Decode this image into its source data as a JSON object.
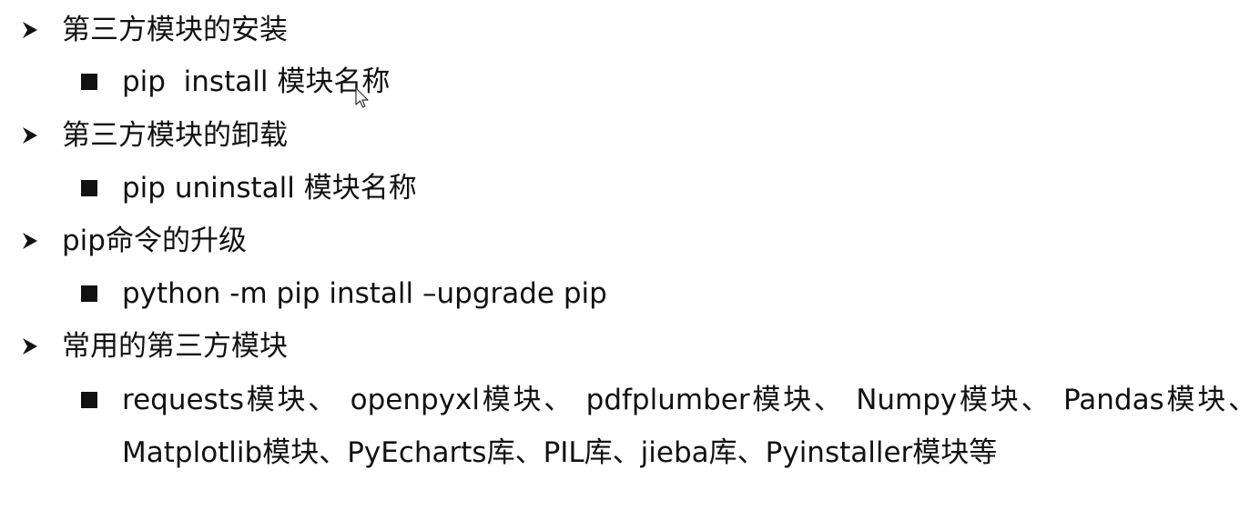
{
  "items": [
    {
      "label": "第三方模块的安装",
      "sub": "pip  install 模块名称"
    },
    {
      "label": "第三方模块的卸载",
      "sub": "pip uninstall 模块名称"
    },
    {
      "label": "pip命令的升级",
      "sub": "python -m pip install –upgrade pip"
    },
    {
      "label": "常用的第三方模块",
      "sub": "requests模块、 openpyxl模块、 pdfplumber模块、 Numpy模块、 Pandas模块、",
      "sub_cont": "Matplotlib模块、PyEcharts库、PIL库、jieba库、Pyinstaller模块等"
    }
  ],
  "icons": {
    "level1": "arrowhead-bullet-icon",
    "level2": "square-bullet-icon",
    "cursor": "mouse-pointer-icon"
  }
}
